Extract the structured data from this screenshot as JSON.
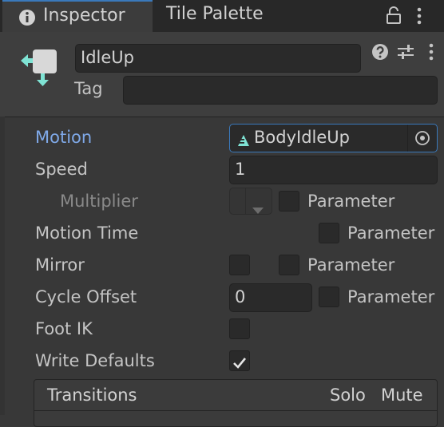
{
  "tabs": {
    "inspector": "Inspector",
    "tile_palette": "Tile Palette"
  },
  "header": {
    "name_value": "IdleUp",
    "tag_label": "Tag",
    "tag_value": ""
  },
  "fields": {
    "motion_label": "Motion",
    "motion_value": "BodyIdleUp",
    "speed_label": "Speed",
    "speed_value": "1",
    "multiplier_label": "Multiplier",
    "multiplier_param": "Parameter",
    "motion_time_label": "Motion Time",
    "motion_time_param": "Parameter",
    "mirror_label": "Mirror",
    "mirror_param": "Parameter",
    "cycle_offset_label": "Cycle Offset",
    "cycle_offset_value": "0",
    "cycle_offset_param": "Parameter",
    "foot_ik_label": "Foot IK",
    "write_defaults_label": "Write Defaults"
  },
  "transitions": {
    "title": "Transitions",
    "solo": "Solo",
    "mute": "Mute"
  },
  "state": {
    "foot_ik_checked": false,
    "write_defaults_checked": true,
    "mirror_checked": false
  },
  "colors": {
    "accent": "#3a79bb",
    "motion_label": "#7fa9e8",
    "panel": "#383838"
  }
}
